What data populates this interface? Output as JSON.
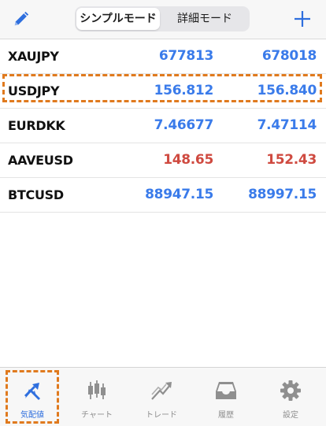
{
  "header": {
    "segments": [
      {
        "label": "シンプルモード",
        "selected": true
      },
      {
        "label": "詳細モード",
        "selected": false
      }
    ]
  },
  "quotes": [
    {
      "symbol": "XAUJPY",
      "bid": "677813",
      "ask": "678018",
      "bid_color": "blue",
      "ask_color": "blue"
    },
    {
      "symbol": "USDJPY",
      "bid": "156.812",
      "ask": "156.840",
      "bid_color": "blue",
      "ask_color": "blue"
    },
    {
      "symbol": "EURDKK",
      "bid": "7.46677",
      "ask": "7.47114",
      "bid_color": "blue",
      "ask_color": "blue"
    },
    {
      "symbol": "AAVEUSD",
      "bid": "148.65",
      "ask": "152.43",
      "bid_color": "red",
      "ask_color": "red"
    },
    {
      "symbol": "BTCUSD",
      "bid": "88947.15",
      "ask": "88997.15",
      "bid_color": "blue",
      "ask_color": "blue"
    }
  ],
  "tabs": [
    {
      "label": "気配値",
      "icon": "quotes-icon",
      "active": true
    },
    {
      "label": "チャート",
      "icon": "candlestick-icon",
      "active": false
    },
    {
      "label": "トレード",
      "icon": "trade-icon",
      "active": false
    },
    {
      "label": "履歴",
      "icon": "history-icon",
      "active": false
    },
    {
      "label": "設定",
      "icon": "gear-icon",
      "active": false
    }
  ],
  "colors": {
    "blue": "#3a7bea",
    "red": "#cf4a40",
    "highlight": "#e07a1e",
    "tab_active": "#2f6fde",
    "tab_inactive": "#8f8f8f"
  }
}
